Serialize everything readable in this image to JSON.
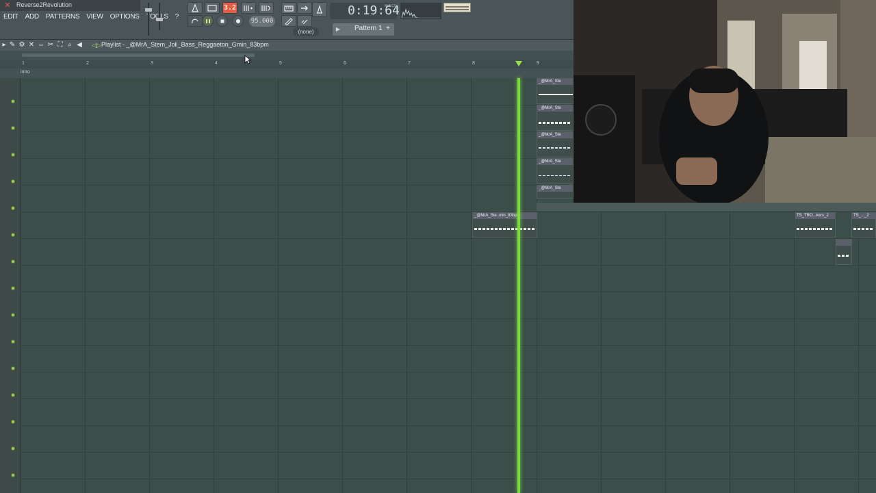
{
  "app": {
    "title": "Reverse2Revolution",
    "menu": [
      "EDIT",
      "ADD",
      "PATTERNS",
      "VIEW",
      "OPTIONS",
      "TOOLS",
      "?"
    ]
  },
  "transport": {
    "tempo_display": "3.2",
    "tempo_value": "95.000",
    "time": "0:19:64",
    "time_unit": "M:S:CS",
    "snap": "(none)",
    "pattern": "Pattern 1"
  },
  "playlist": {
    "title": "Playlist - _@MrA_Stem_Joli_Bass_Reggaeton_Gmin_83bpm",
    "bars": [
      "1",
      "2",
      "3",
      "4",
      "5",
      "6",
      "7",
      "8",
      "9"
    ],
    "marker": "intro",
    "clips": [
      {
        "name": "_@MrA_Ste"
      },
      {
        "name": "_@MrA_Ste"
      },
      {
        "name": "_@MrA_Ste"
      },
      {
        "name": "_@MrA_Ste"
      },
      {
        "name": "_@MrA_Ste"
      },
      {
        "name": "_@MrA_Ste..min_83bpm"
      },
      {
        "name": "TS_TRO...kers_2"
      },
      {
        "name": "TS_..._2"
      }
    ]
  },
  "colors": {
    "playhead": "#7adb3a",
    "grid_bg": "#3b4e4a",
    "led": "#9acd48",
    "record_red": "#e45b4a"
  }
}
